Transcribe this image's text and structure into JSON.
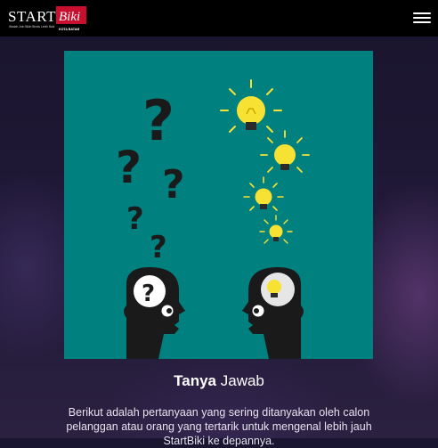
{
  "navbar": {
    "logo": {
      "word_start": "START",
      "word_biki": "Biki",
      "tagline": "Wadah Join Bikin Bisnis Lebih Baik",
      "city": "KOTA BATAM"
    },
    "menu_icon": "hamburger-menu-icon"
  },
  "hero": {
    "illustration": "two-heads-questions-and-lightbulbs",
    "bg_color": "#00807f"
  },
  "section": {
    "title_bold": "Tanya",
    "title_regular": "Jawab",
    "description": "Berikut adalah pertanyaan yang sering ditanyakan oleh calon pelanggan atau orang yang tertarik untuk mengenal lebih jauh StartBiki ke depannya."
  },
  "colors": {
    "navbar_bg": "#000000",
    "logo_red": "#c8102e",
    "bulb_yellow": "#f7e234",
    "head_dark": "#1a1a1a",
    "text_white": "#ffffff"
  }
}
